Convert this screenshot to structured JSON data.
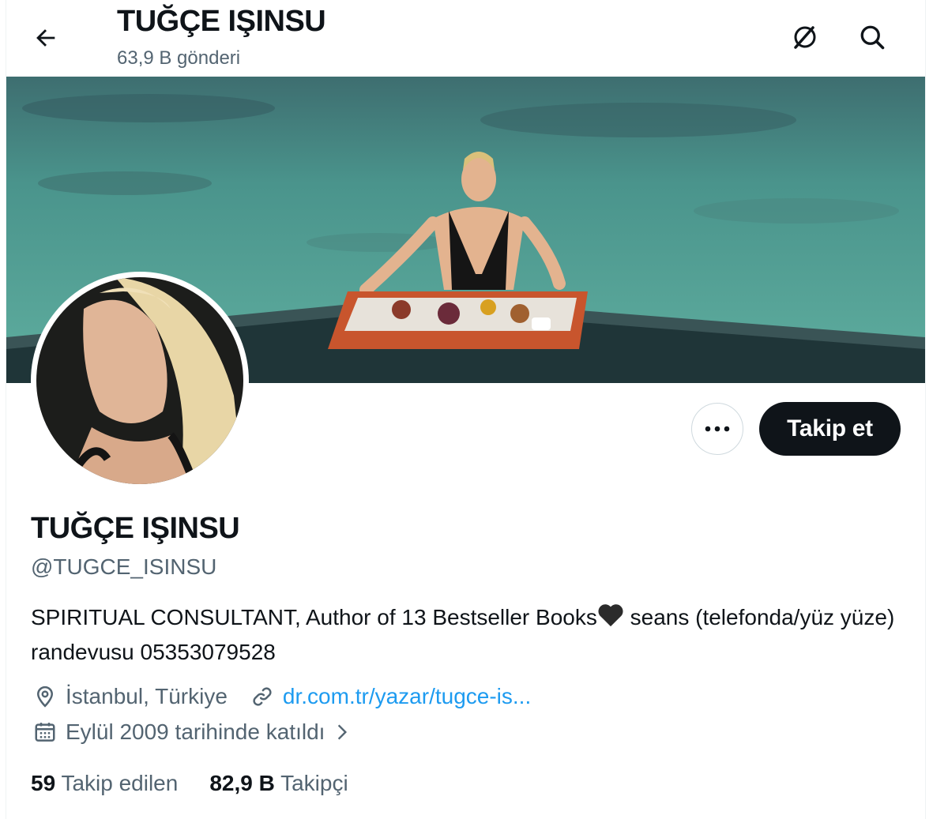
{
  "header": {
    "title": "TUĞÇE IŞINSU",
    "post_count": "63,9 B gönderi",
    "icons": [
      "back-arrow-icon",
      "grok-icon",
      "search-icon"
    ]
  },
  "banner": {
    "description_icon": "banner-image"
  },
  "actions": {
    "more_label": "•••",
    "follow_label": "Takip et"
  },
  "profile": {
    "display_name": "TUĞÇE IŞINSU",
    "handle": "@TUGCE_ISINSU",
    "bio_part1": "SPIRITUAL CONSULTANT, Author of 13 Bestseller Books",
    "bio_part2": " seans (telefonda/yüz yüze) randevusu 05353079528",
    "location": "İstanbul, Türkiye",
    "website": "dr.com.tr/yazar/tugce-is...",
    "joined": "Eylül 2009 tarihinde katıldı"
  },
  "stats": {
    "following_count": "59",
    "following_label": "Takip edilen",
    "followers_count": "82,9 B",
    "followers_label": "Takipçi"
  },
  "colors": {
    "text": "#0f1419",
    "secondary": "#536471",
    "link": "#1d9bf0",
    "button_dark": "#0f1419",
    "border": "#cfd9de"
  }
}
